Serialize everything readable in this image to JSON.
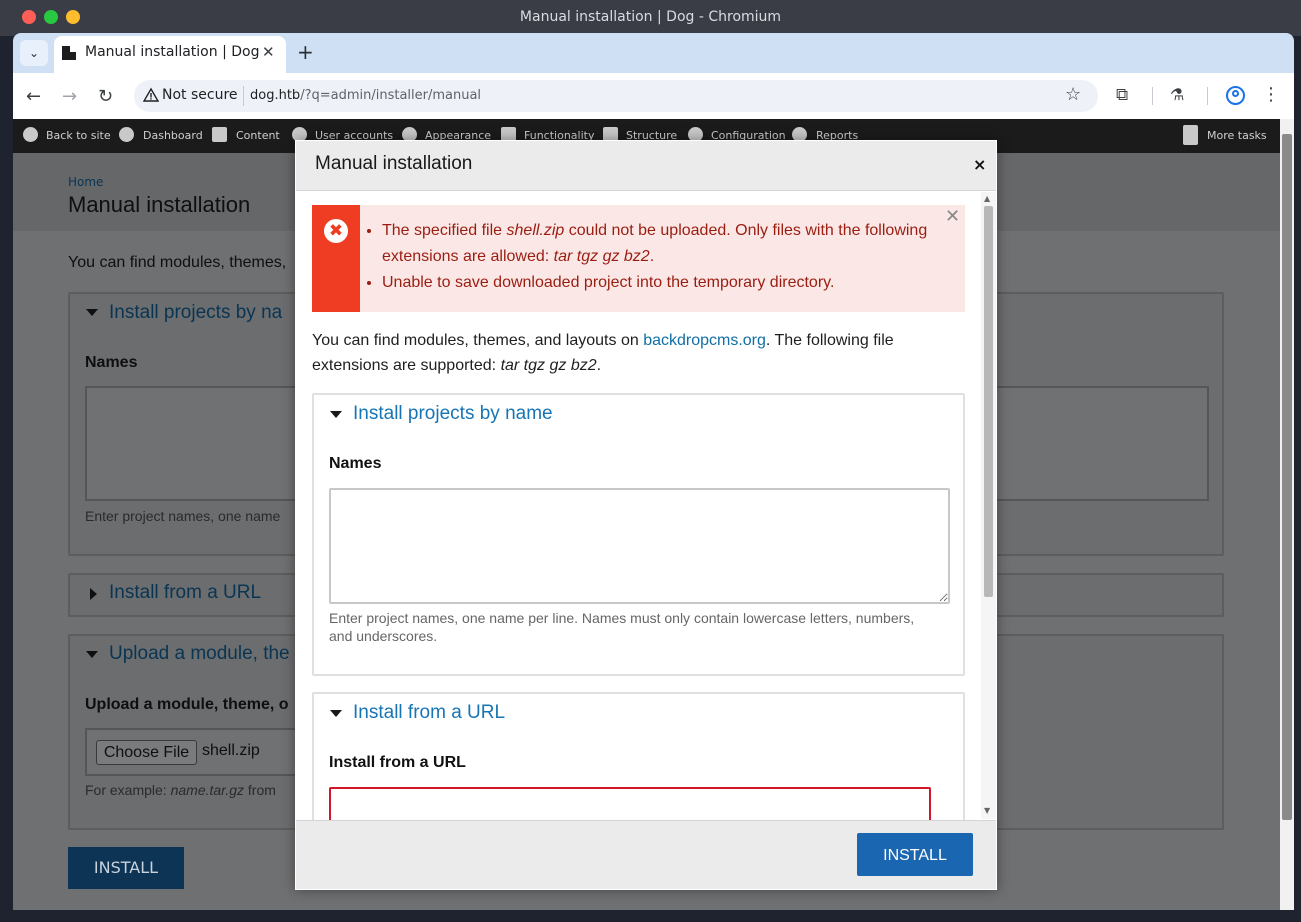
{
  "window": {
    "title": "Manual installation | Dog - Chromium"
  },
  "browser": {
    "tab_title": "Manual installation | Dog",
    "security_label": "Not secure",
    "url_host": "dog.htb",
    "url_path": "/?q=admin/installer/manual"
  },
  "admin_bar": {
    "items": [
      "Back to site",
      "Dashboard",
      "Content",
      "User accounts",
      "Appearance",
      "Functionality",
      "Structure",
      "Configuration",
      "Reports"
    ],
    "more_tasks": "More tasks"
  },
  "page": {
    "breadcrumb": "Home",
    "title": "Manual installation",
    "intro": "You can find modules, themes,",
    "section1_legend": "Install projects by na",
    "names_label": "Names",
    "names_help": "Enter project names, one name",
    "section2_legend": "Install from a URL",
    "section3_legend": "Upload a module, the",
    "upload_label": "Upload a module, theme, o",
    "choose_file": "Choose File",
    "file_name": "shell.zip",
    "upload_help_prefix": "For example: ",
    "upload_help_em": "name.tar.gz",
    "upload_help_suffix": " from",
    "install_button": "INSTALL"
  },
  "modal": {
    "title": "Manual installation",
    "close": "×",
    "errors": {
      "e1_a": "The specified file ",
      "e1_file": "shell.zip",
      "e1_b": " could not be uploaded. Only files with the following extensions are allowed: ",
      "e1_ext": "tar tgz gz bz2",
      "e1_end": ".",
      "e2": "Unable to save downloaded project into the temporary directory."
    },
    "intro_a": "You can find modules, themes, and layouts on ",
    "intro_link": "backdropcms.org",
    "intro_b": ". The following file extensions are supported: ",
    "intro_ext": "tar tgz gz bz2",
    "intro_end": ".",
    "section1_legend": "Install projects by name",
    "names_label": "Names",
    "names_value": "",
    "names_help": "Enter project names, one name per line. Names must only contain lowercase letters, numbers, and underscores.",
    "section2_legend": "Install from a URL",
    "url_label": "Install from a URL",
    "url_value": "",
    "install_button": "INSTALL"
  }
}
